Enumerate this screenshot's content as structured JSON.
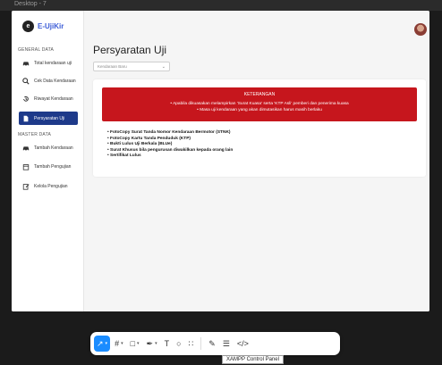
{
  "window": {
    "title": "Desktop - 7"
  },
  "app": {
    "logo_text": "E-UjiKir",
    "sidebar": {
      "general_title": "GENERAL DATA",
      "general_items": [
        {
          "label": "Total kendaraan uji",
          "icon": "car-icon"
        },
        {
          "label": "Cek Data Kendaraan",
          "icon": "search-icon"
        },
        {
          "label": "Riwayat Kendaraan",
          "icon": "history-icon"
        },
        {
          "label": "Persyaratan Uji",
          "icon": "document-icon",
          "active": true
        }
      ],
      "master_title": "MASTER DATA",
      "master_items": [
        {
          "label": "Tambah Kendaraan",
          "icon": "car-icon"
        },
        {
          "label": "Tambah Pengujian",
          "icon": "calendar-icon"
        },
        {
          "label": "Kelola Pengujian",
          "icon": "edit-icon"
        }
      ]
    },
    "page_title": "Persyaratan Uji",
    "select": {
      "value": "Kendaraan Baru"
    },
    "alert": {
      "title": "KETERANGAN",
      "items": [
        "Apabila dikuasakan melampirkan 'Surat Kuasa' serta 'KTP Asli' pemberi dan penerima kuasa",
        "Masa uji kendaraan yang akan dimutasikan harus masih berlaku"
      ]
    },
    "requirements": [
      "FotoCopy Surat Tanda Nomor Kendaraan Bermotor (STNK)",
      "FotoCopy Kartu Tanda Penduduk (KTP)",
      "Bukti  Lulus Uji Berkala (BLUe)",
      "Surat Khusus bila pengurusan diwakilkan kepada orang lain",
      "Sertifikat Lulus"
    ],
    "colors": {
      "primary": "#1e3a8a",
      "alert": "#c6161d"
    }
  },
  "toolbar": {
    "tools": [
      {
        "name": "move-tool",
        "glyph": "↗",
        "active": true,
        "dropdown": true
      },
      {
        "name": "frame-tool",
        "glyph": "#",
        "dropdown": true
      },
      {
        "name": "shape-tool",
        "glyph": "□",
        "dropdown": true
      },
      {
        "name": "pen-tool",
        "glyph": "✒",
        "dropdown": true
      },
      {
        "name": "text-tool",
        "glyph": "T"
      },
      {
        "name": "comment-tool",
        "glyph": "○"
      },
      {
        "name": "components-tool",
        "glyph": "∷"
      },
      {
        "name": "draw-tool",
        "glyph": "✎"
      },
      {
        "name": "dev-mode-tool",
        "glyph": "☰"
      },
      {
        "name": "code-tool",
        "glyph": "</>"
      }
    ],
    "tooltip": "XAMPP Control Panel"
  }
}
